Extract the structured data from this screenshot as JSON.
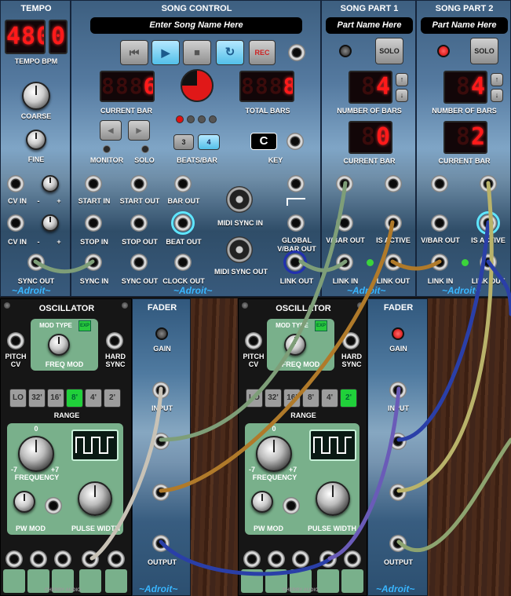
{
  "tempo": {
    "title": "TEMPO",
    "digits": "480",
    "decimal": "0",
    "bpm_label": "TEMPO BPM",
    "coarse_label": "COARSE",
    "fine_label": "FINE",
    "cv_in_label": "CV IN",
    "minus": "-",
    "plus": "+",
    "sync_out_label": "SYNC OUT",
    "brand": "~Adroit~"
  },
  "song_control": {
    "title": "SONG CONTROL",
    "song_name": "Enter Song Name Here",
    "rec_label": "REC",
    "current_bar": "6",
    "current_bar_label": "CURRENT BAR",
    "total_bars": "8",
    "total_bars_label": "TOTAL BARS",
    "monitor_label": "MONITOR",
    "solo_label": "SOLO",
    "beats_per_bar_label": "BEATS/BAR",
    "beats_options": [
      "3",
      "4"
    ],
    "beats_selected": "4",
    "key_value": "C",
    "key_label": "KEY",
    "jack_labels": [
      "START IN",
      "START OUT",
      "BAR OUT",
      "STOP IN",
      "STOP OUT",
      "BEAT OUT",
      "SYNC IN",
      "SYNC OUT",
      "CLOCK OUT"
    ],
    "midi_sync_in": "MIDI SYNC IN",
    "midi_sync_out": "MIDI SYNC OUT",
    "global_vbar_out": "GLOBAL V/BAR OUT",
    "link_out": "LINK OUT",
    "brand": "~Adroit~"
  },
  "song_part_1": {
    "title": "SONG PART 1",
    "name": "Part Name Here",
    "solo_label": "SOLO",
    "number_of_bars": "4",
    "number_of_bars_label": "NUMBER OF BARS",
    "current_bar": "0",
    "current_bar_label": "CURRENT BAR",
    "vbar_out_label": "V/BAR OUT",
    "is_active_label": "IS ACTIVE",
    "link_in_label": "LINK IN",
    "link_out_label": "LINK OUT",
    "brand": "~Adroit~"
  },
  "song_part_2": {
    "title": "SONG PART 2",
    "name": "Part Name Here",
    "solo_label": "SOLO",
    "number_of_bars": "4",
    "number_of_bars_label": "NUMBER OF BARS",
    "current_bar": "2",
    "current_bar_label": "CURRENT BAR",
    "vbar_out_label": "V/BAR OUT",
    "is_active_label": "IS ACTIVE",
    "link_in_label": "LINK IN",
    "link_out_label": "LINK OUT",
    "brand": "~Adroit~"
  },
  "oscillator_1": {
    "title": "OSCILLATOR",
    "mod_type_label": "MOD TYPE",
    "exp_label": "EXP",
    "freq_mod_label": "FREQ MOD",
    "pitch_cv_label": "PITCH CV",
    "hard_sync_label": "HARD SYNC",
    "range_options": [
      "LO",
      "32'",
      "16'",
      "8'",
      "4'",
      "2'"
    ],
    "range_selected": "8'",
    "range_label": "RANGE",
    "freq_min": "-7",
    "freq_zero": "0",
    "freq_max": "+7",
    "frequency_label": "FREQUENCY",
    "pw_mod_label": "PW MOD",
    "pulse_width_label": "PULSE WIDTH",
    "maker": "CHERRY AUDIO"
  },
  "oscillator_2": {
    "title": "OSCILLATOR",
    "mod_type_label": "MOD TYPE",
    "exp_label": "EXP",
    "freq_mod_label": "FREQ MOD",
    "pitch_cv_label": "PITCH CV",
    "hard_sync_label": "HARD SYNC",
    "range_options": [
      "LO",
      "32'",
      "16'",
      "8'",
      "4'",
      "2'"
    ],
    "range_selected": "2'",
    "range_label": "RANGE",
    "freq_min": "-7",
    "freq_zero": "0",
    "freq_max": "+7",
    "frequency_label": "FREQUENCY",
    "pw_mod_label": "PW MOD",
    "pulse_width_label": "PULSE WIDTH",
    "maker": "CHERRY AUDIO"
  },
  "fader_1": {
    "title": "FADER",
    "gain_label": "GAIN",
    "input_label": "INPUT",
    "output_label": "OUTPUT",
    "brand": "~Adroit~"
  },
  "fader_2": {
    "title": "FADER",
    "gain_label": "GAIN",
    "input_label": "INPUT",
    "output_label": "OUTPUT",
    "brand": "~Adroit~"
  },
  "colors": {
    "led_red": "#ff1a1a",
    "link_blue": "#39b6ff",
    "cable_green": "#7e9e78",
    "cable_orange": "#b07a2a",
    "cable_blue": "#2a3fa8",
    "cable_yellow": "#b9b36a"
  }
}
